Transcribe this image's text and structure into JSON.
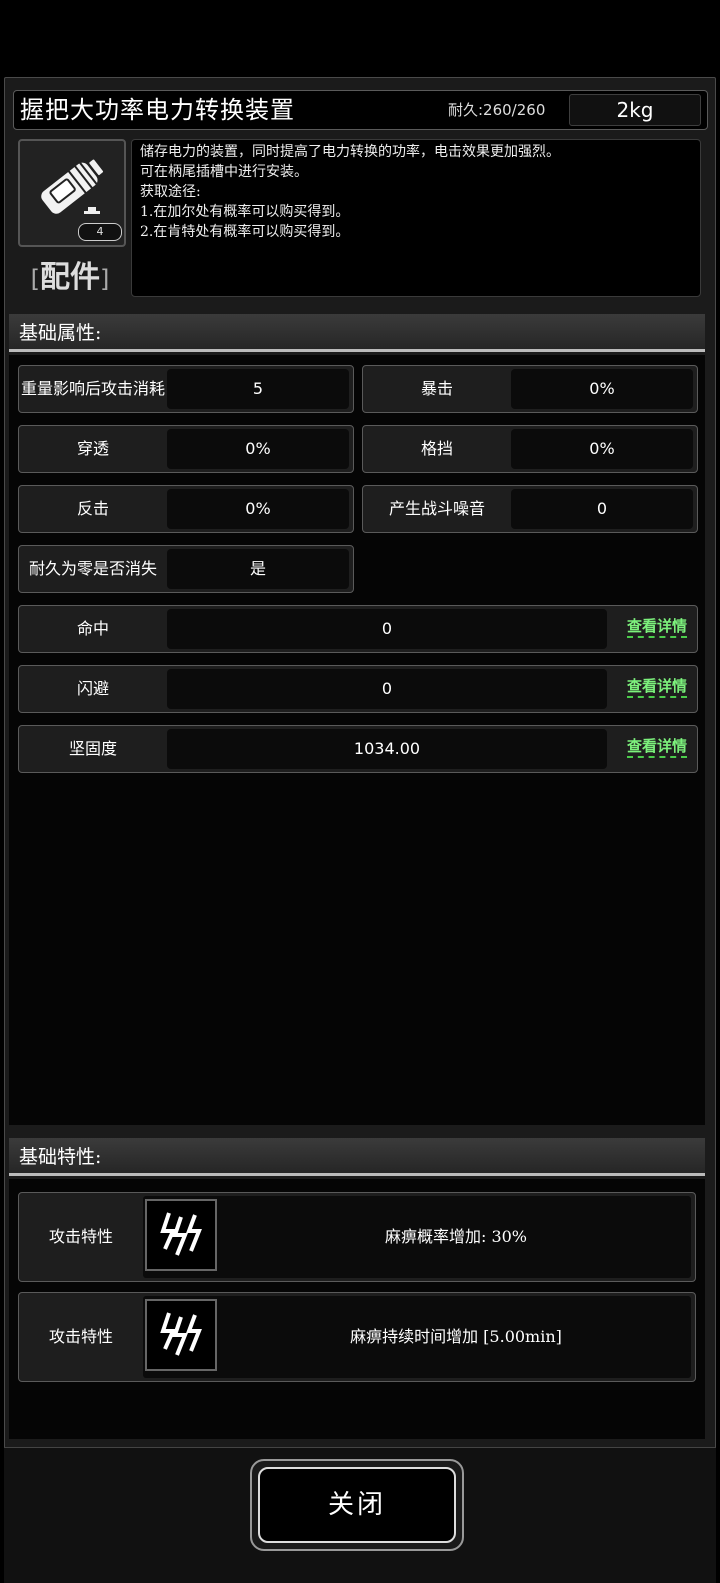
{
  "item": {
    "name": "握把大功率电力转换装置",
    "durability": "耐久:260/260",
    "weight": "2kg",
    "icon": "battery-icon",
    "badge": "4",
    "category_bracket_left": "[",
    "category": "配件",
    "category_bracket_right": "]"
  },
  "description": {
    "lines": [
      "储存电力的装置，同时提高了电力转换的功率，电击效果更加强烈。",
      "可在柄尾插槽中进行安装。",
      "获取途径:",
      "1.在加尔处有概率可以购买得到。",
      "2.在肯特处有概率可以购买得到。"
    ]
  },
  "basic_attributes": {
    "title": "基础属性:",
    "stats": [
      {
        "label": "重量影响后攻击消耗",
        "value": "5"
      },
      {
        "label": "暴击",
        "value": "0%"
      },
      {
        "label": "穿透",
        "value": "0%"
      },
      {
        "label": "格挡",
        "value": "0%"
      },
      {
        "label": "反击",
        "value": "0%"
      },
      {
        "label": "产生战斗噪音",
        "value": "0"
      },
      {
        "label": "耐久为零是否消失",
        "value": "是"
      }
    ],
    "wide_stats": [
      {
        "label": "命中",
        "value": "0",
        "link": "查看详情"
      },
      {
        "label": "闪避",
        "value": "0",
        "link": "查看详情"
      },
      {
        "label": "坚固度",
        "value": "1034.00",
        "link": "查看详情"
      }
    ]
  },
  "basic_traits": {
    "title": "基础特性:",
    "traits": [
      {
        "label": "攻击特性",
        "icon": "lightning-icon",
        "text": "麻痹概率增加: 30%"
      },
      {
        "label": "攻击特性",
        "icon": "lightning-icon",
        "text": "麻痹持续时间增加 [5.00min]"
      }
    ]
  },
  "footer": {
    "close_label": "关闭"
  }
}
